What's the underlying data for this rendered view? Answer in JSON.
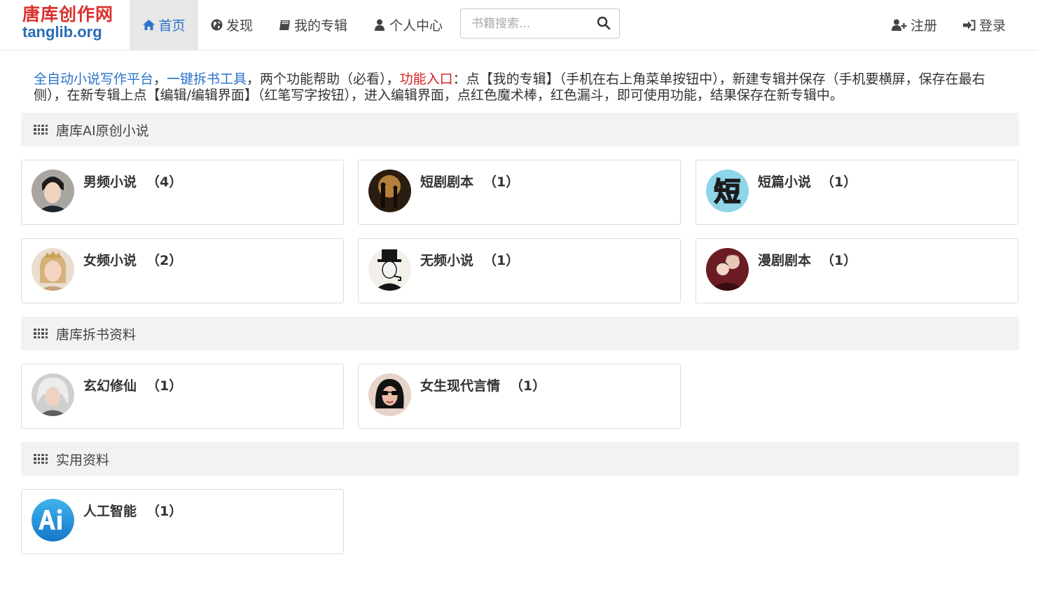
{
  "brand": {
    "name_cn": "唐库创作网",
    "name_en": "tanglib.org"
  },
  "nav": {
    "home": "首页",
    "discover": "发现",
    "albums": "我的专辑",
    "user_center": "个人中心",
    "register": "注册",
    "login": "登录"
  },
  "search": {
    "placeholder": "书籍搜索..."
  },
  "notice": {
    "link1": "全自动小说写作平台",
    "sep1": "，",
    "link2": "一键拆书工具",
    "mid": "，两个功能帮助（必看），",
    "red": "功能入口",
    "rest": "：点【我的专辑】（手机在右上角菜单按钮中），新建专辑并保存（手机要横屏，保存在最右侧），在新专辑上点【编辑/编辑界面】（红笔写字按钮），进入编辑界面，点红色魔术棒，红色漏斗，即可使用功能，结果保存在新专辑中。"
  },
  "sections": [
    {
      "title": "唐库AI原创小说",
      "cards": [
        {
          "name": "男频小说",
          "count": "（4）",
          "avatar": "male-portrait-avatar"
        },
        {
          "name": "短剧剧本",
          "count": "（1）",
          "avatar": "street-silhouette-avatar"
        },
        {
          "name": "短篇小说",
          "count": "（1）",
          "avatar": "short-character-avatar"
        },
        {
          "name": "女频小说",
          "count": "（2）",
          "avatar": "crowned-woman-avatar"
        },
        {
          "name": "无频小说",
          "count": "（1）",
          "avatar": "top-hat-man-avatar"
        },
        {
          "name": "漫剧剧本",
          "count": "（1）",
          "avatar": "couple-avatar"
        }
      ]
    },
    {
      "title": "唐库拆书资料",
      "cards": [
        {
          "name": "玄幻修仙",
          "count": "（1）",
          "avatar": "white-hair-hero-avatar"
        },
        {
          "name": "女生现代言情",
          "count": "（1）",
          "avatar": "sunglasses-woman-avatar"
        }
      ]
    },
    {
      "title": "实用资料",
      "cards": [
        {
          "name": "人工智能",
          "count": "（1）",
          "avatar": "ai-logo-avatar"
        }
      ]
    }
  ],
  "colors": {
    "brand_red": "#d9302c",
    "brand_blue": "#2a6db5",
    "link_blue": "#2a73c9",
    "notice_red": "#d42020"
  }
}
